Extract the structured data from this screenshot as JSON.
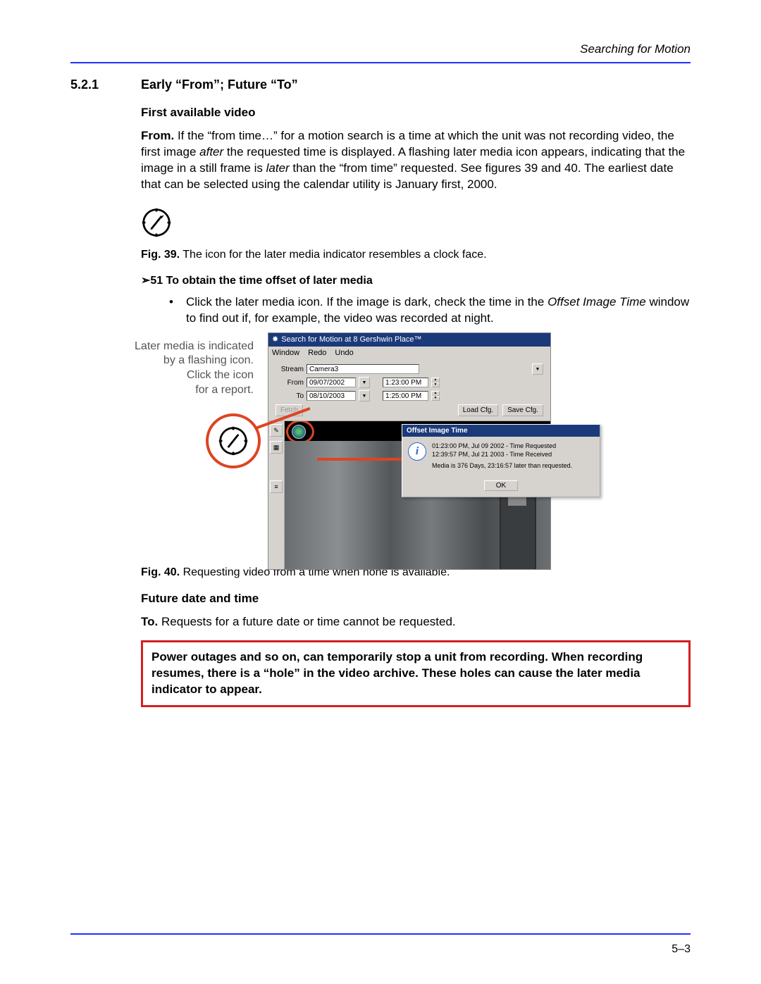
{
  "header": {
    "running": "Searching for Motion"
  },
  "section": {
    "number": "5.2.1",
    "title": "Early “From”; Future “To”"
  },
  "h1": "First available video",
  "p1": {
    "lead": "From.",
    "a": " If the “from time…” for a motion search is a time at which the unit was not recording video, the first image ",
    "i1": "after",
    "b": " the requested time is displayed. A flashing later media icon appears, indicating that the image in a still frame is ",
    "i2": "later",
    "c": " than the “from time” requested. See figures 39 and 40. The earliest date that can be selected using the calendar utility is January first, 2000."
  },
  "fig39": {
    "label": "Fig. 39.",
    "text": " The icon for the later media indicator resembles a clock face."
  },
  "proc": {
    "arrow": "➢",
    "num": "51",
    "title": "  To obtain the time offset of later media"
  },
  "bullet1": {
    "a": "Click the later media icon. If the image is dark, check the time in the ",
    "i": "Offset Image Time",
    "b": " window to find out if, for example, the video was recorded at night."
  },
  "annot": {
    "l1": "Later media is indicated",
    "l2": "by a flashing icon.",
    "l3": "Click the icon",
    "l4": "for a report."
  },
  "app": {
    "title": "Search for Motion at 8 Gershwin Place™",
    "menu": {
      "m1": "Window",
      "m2": "Redo",
      "m3": "Undo"
    },
    "labels": {
      "stream": "Stream",
      "from": "From",
      "to": "To"
    },
    "fields": {
      "stream": "Camera3",
      "from_date": "09/07/2002",
      "from_time": "1:23:00 PM",
      "to_date": "08/10/2003",
      "to_time": "1:25:00 PM"
    },
    "buttons": {
      "fetch": "Fetch",
      "load": "Load Cfg.",
      "save": "Save Cfg."
    }
  },
  "popup": {
    "title": "Offset Image Time",
    "line1": "01:23:00 PM, Jul 09 2002 - Time Requested",
    "line2": "12:39:57 PM, Jul 21 2003 - Time Received",
    "line3": "Media is 376 Days, 23:16:57 later than requested.",
    "ok": "OK"
  },
  "fig40": {
    "label": "Fig. 40.",
    "text": " Requesting video from a time when none is available."
  },
  "h2": "Future date and time",
  "p2": {
    "lead": "To.",
    "text": " Requests for a future date or time cannot be requested."
  },
  "note": "Power outages and so on, can temporarily stop a unit from recording. When recording resumes, there is a “hole” in the video archive. These holes can cause the later media indicator to appear.",
  "footer": {
    "pagenum": "5–3"
  }
}
